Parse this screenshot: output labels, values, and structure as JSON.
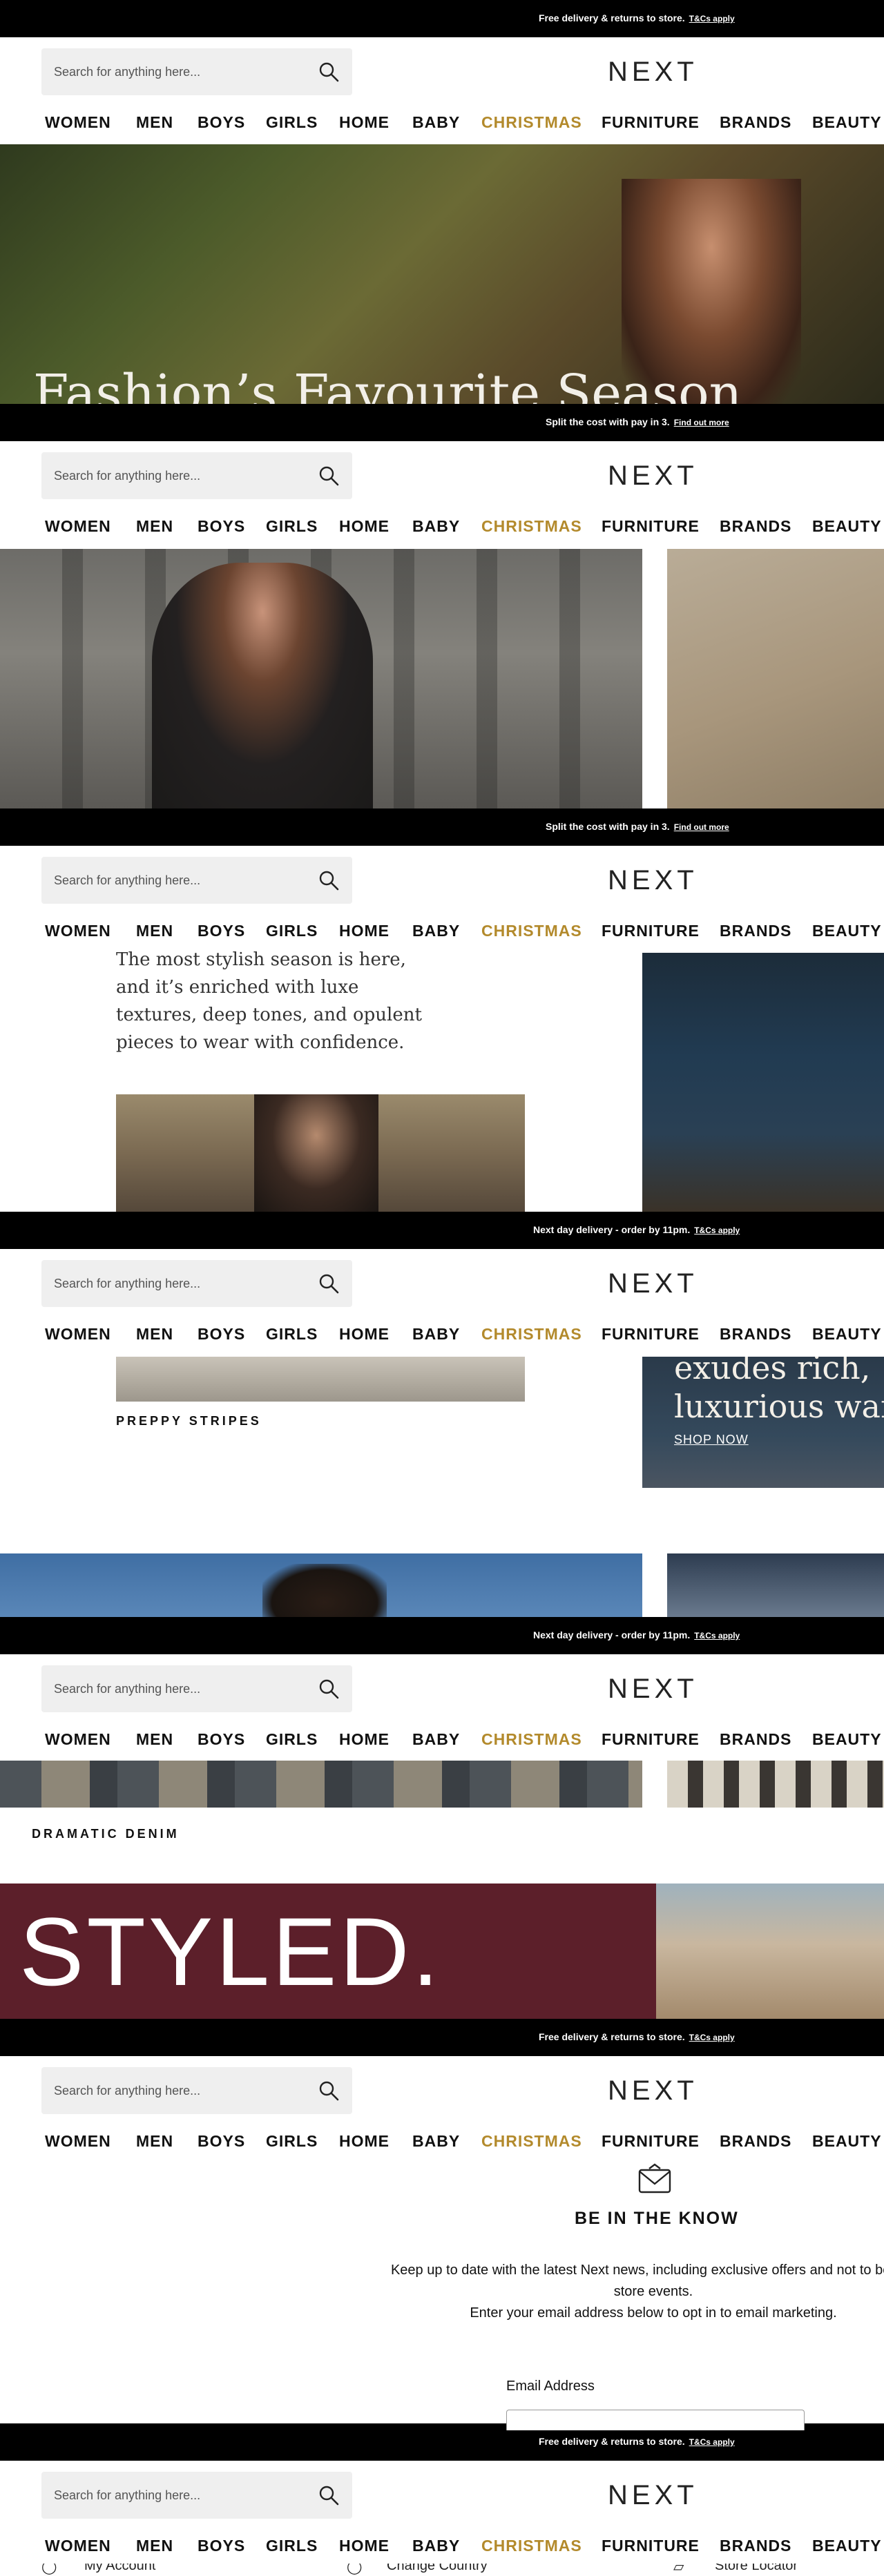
{
  "promos": [
    {
      "text": "Free delivery & returns to store.",
      "link": "T&Cs apply"
    },
    {
      "text": "Split the cost with pay in 3.",
      "link": "Find out more"
    },
    {
      "text": "Split the cost with pay in 3.",
      "link": "Find out more"
    },
    {
      "text": "Next day delivery - order by 11pm.",
      "link": "T&Cs apply"
    },
    {
      "text": "Next day delivery - order by 11pm.",
      "link": "T&Cs apply"
    },
    {
      "text": "Free delivery & returns to store.",
      "link": "T&Cs apply"
    },
    {
      "text": "Free delivery & returns to store.",
      "link": "T&Cs apply"
    }
  ],
  "header": {
    "search_placeholder": "Search for anything here...",
    "logo": "NEXT",
    "nav": [
      "WOMEN",
      "MEN",
      "BOYS",
      "GIRLS",
      "HOME",
      "BABY",
      "CHRISTMAS",
      "FURNITURE",
      "BRANDS",
      "BEAUTY"
    ],
    "accent_color": "#b38a2c"
  },
  "hero": {
    "title": "Fashion’s Favourite Season"
  },
  "intro": {
    "text": "The most stylish season is here, and it’s enriched with luxe textures, deep tones, and opulent pieces to wear with confidence."
  },
  "tiles": {
    "preppy": "PREPPY STRIPES",
    "luxe_heading_1": "exudes rich,",
    "luxe_heading_2": "luxurious war",
    "shop_now": "SHOP NOW",
    "denim": "DRAMATIC DENIM",
    "styled": "STYLED."
  },
  "newsletter": {
    "title": "BE IN THE KNOW",
    "line1": "Keep up to date with the latest Next news, including exclusive offers and not to be mis",
    "line2": "store events.",
    "line3": "Enter your email address below to opt in to email marketing.",
    "email_label": "Email Address"
  },
  "footer": {
    "account": "My Account",
    "country": "Change Country",
    "store": "Store Locator"
  }
}
